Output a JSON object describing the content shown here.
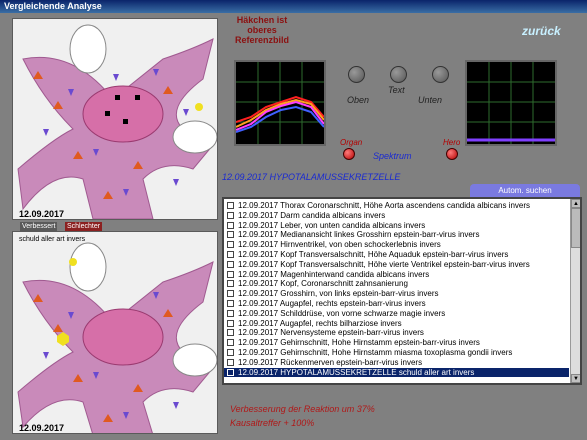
{
  "title": "Vergleichende Analyse",
  "hint": [
    "Häkchen ist oberes",
    "Referenzbild"
  ],
  "back": "zurück",
  "top_date": "12.09.2017",
  "bottom_date": "12.09.2017",
  "tabs": {
    "improved": "Verbessert",
    "worse": "Schlechter"
  },
  "bottom_caption": "schuld aller art invers",
  "controls": {
    "oben": "Oben",
    "text": "Text",
    "unten": "Unten",
    "organ": "Organ",
    "spektrum": "Spektrum",
    "hero": "Hero"
  },
  "selected_heading": "12.09.2017 HYPOTALAMUSSEKRETZELLE",
  "autom_search": "Autom. suchen",
  "colors": {
    "accent": "#0a246a",
    "led": "#b30000",
    "blue": "#1a2ad0"
  },
  "list": [
    {
      "date": "12.09.2017",
      "text": "Thorax Coronarschnitt, Höhe Aorta ascendens  candida albicans invers"
    },
    {
      "date": "12.09.2017",
      "text": "Darm  candida albicans invers"
    },
    {
      "date": "12.09.2017",
      "text": "Leber, von unten  candida albicans invers"
    },
    {
      "date": "12.09.2017",
      "text": "Medianansicht linkes Grosshirn  epstein-barr-virus invers"
    },
    {
      "date": "12.09.2017",
      "text": "Hirnventrikel, von oben  schockerlebnis invers"
    },
    {
      "date": "12.09.2017",
      "text": "Kopf Transversalschnitt, Höhe Aquaduk  epstein-barr-virus invers"
    },
    {
      "date": "12.09.2017",
      "text": "Kopf Transversalschnitt, Höhe vierte Ventrikel  epstein-barr-virus invers"
    },
    {
      "date": "12.09.2017",
      "text": "Magenhinterwand  candida albicans invers"
    },
    {
      "date": "12.09.2017",
      "text": "Kopf, Coronarschnitt  zahnsanierung"
    },
    {
      "date": "12.09.2017",
      "text": "Grosshirn, von links  epstein-barr-virus invers"
    },
    {
      "date": "12.09.2017",
      "text": "Augapfel, rechts  epstein-barr-virus invers"
    },
    {
      "date": "12.09.2017",
      "text": "Schilddrüse, von vorne  schwarze magie invers"
    },
    {
      "date": "12.09.2017",
      "text": "Augapfel, rechts  bilharziose invers"
    },
    {
      "date": "12.09.2017",
      "text": "Nervensysteme  epstein-barr-virus invers"
    },
    {
      "date": "12.09.2017",
      "text": "Gehirnschnitt, Hohe Hirnstamm  epstein-barr-virus invers"
    },
    {
      "date": "12.09.2017",
      "text": "Gehirnschnitt, Hohe Hirnstamm  miasma toxoplasma gondii invers"
    },
    {
      "date": "12.09.2017",
      "text": "Rückenmerven  epstein-barr-virus invers"
    },
    {
      "date": "12.09.2017",
      "text": "HYPOTALAMUSSEKRETZELLE  schuld aller art invers",
      "selected": true
    }
  ],
  "results": [
    "Verbesserung der Reaktion um 37%",
    "Kausaltreffer + 100%"
  ]
}
